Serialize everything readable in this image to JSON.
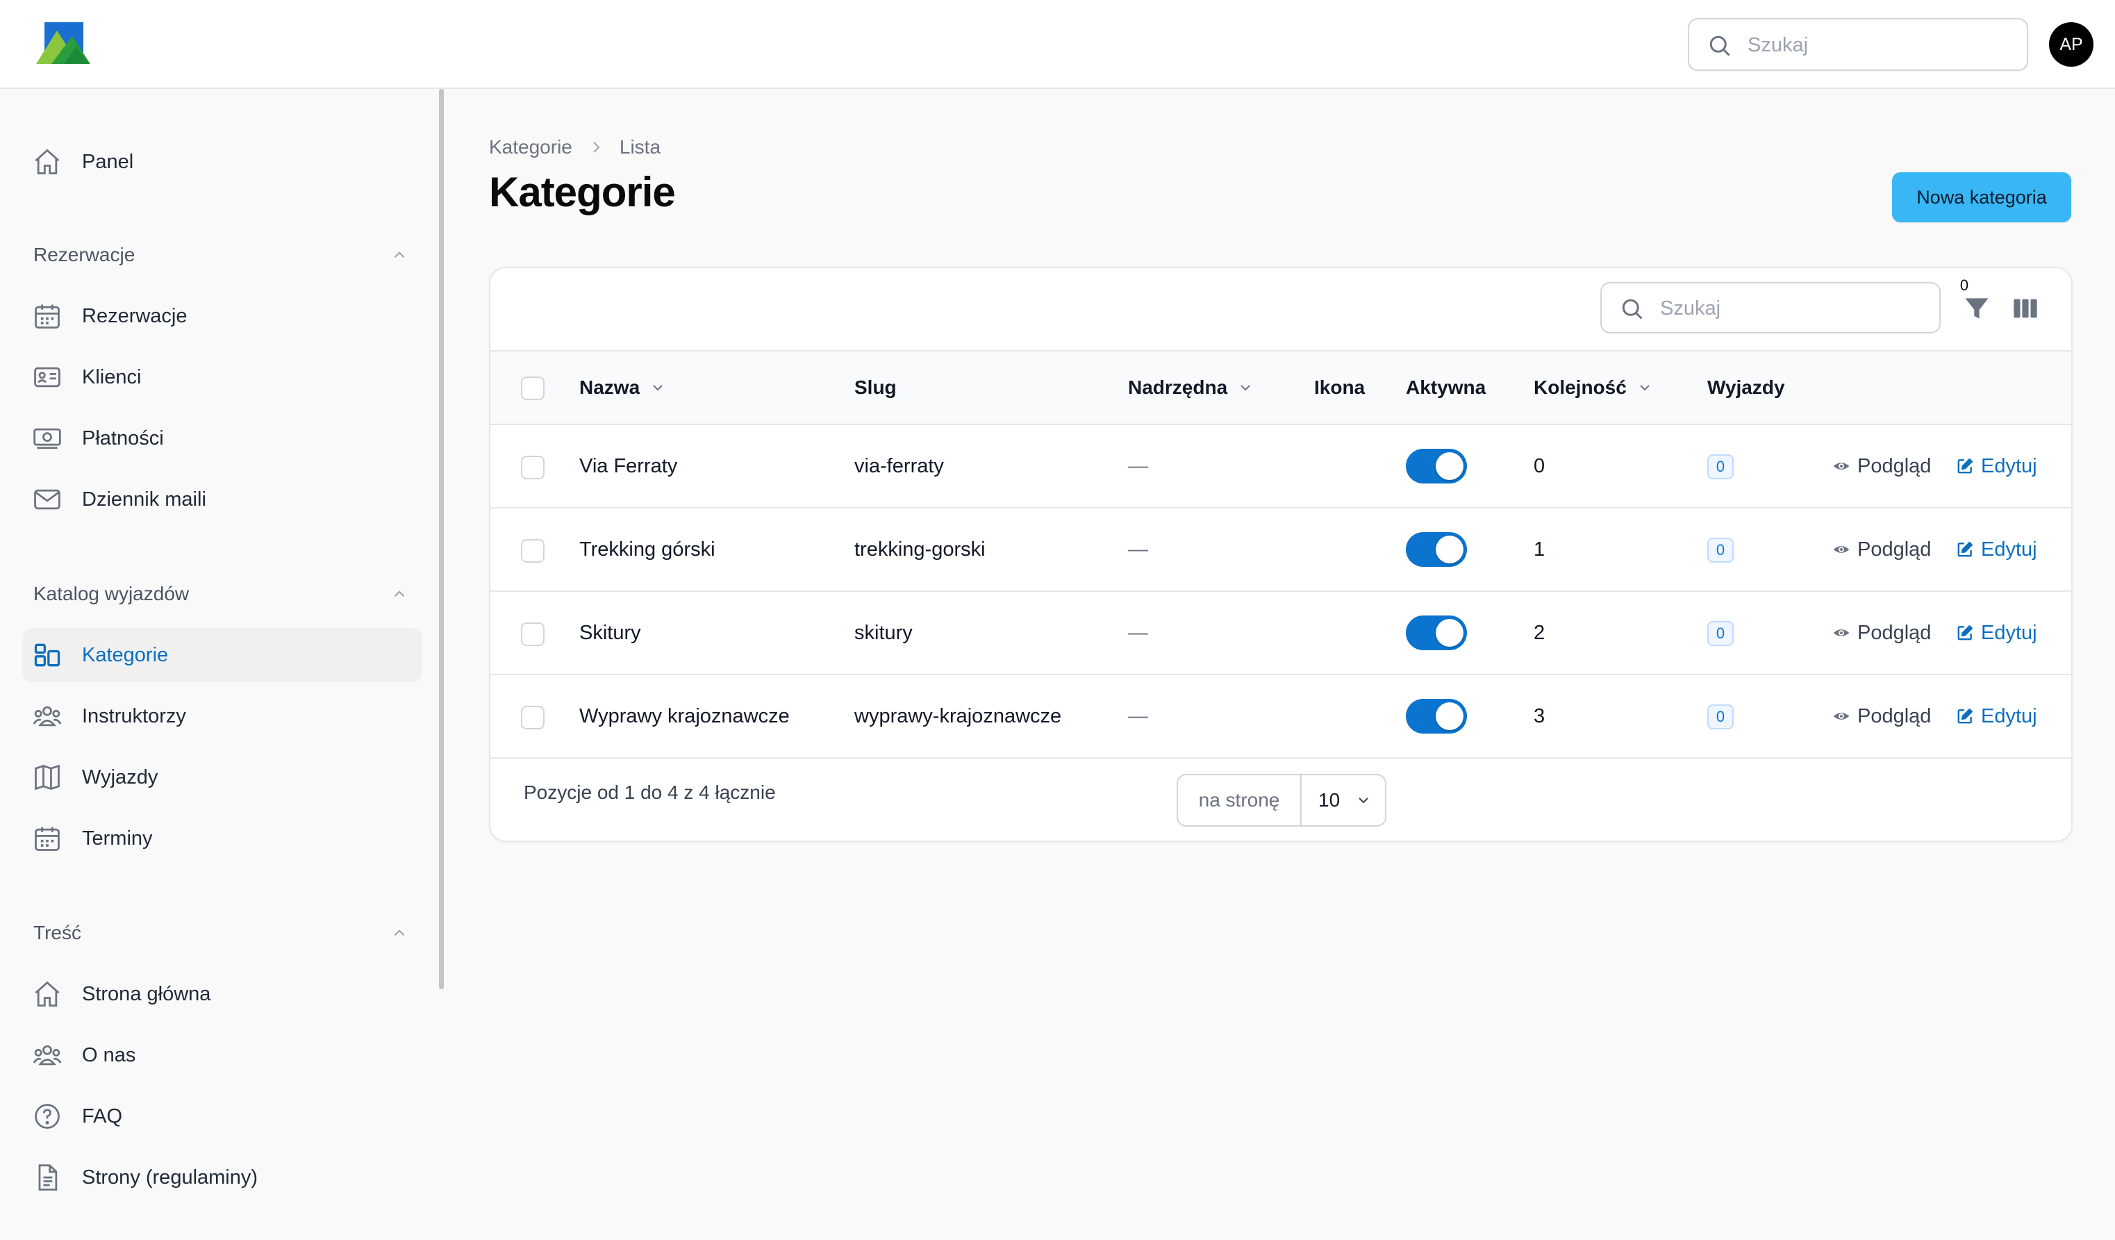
{
  "topbar": {
    "search_placeholder": "Szukaj",
    "avatar_initials": "AP"
  },
  "sidebar": {
    "top_item": {
      "label": "Panel",
      "icon": "home-icon"
    },
    "groups": [
      {
        "label": "Rezerwacje",
        "items": [
          {
            "label": "Rezerwacje",
            "icon": "calendar-icon"
          },
          {
            "label": "Klienci",
            "icon": "id-card-icon"
          },
          {
            "label": "Płatności",
            "icon": "cash-icon"
          },
          {
            "label": "Dziennik maili",
            "icon": "envelope-icon"
          }
        ]
      },
      {
        "label": "Katalog wyjazdów",
        "items": [
          {
            "label": "Kategorie",
            "icon": "squares-icon",
            "active": true
          },
          {
            "label": "Instruktorzy",
            "icon": "user-group-icon"
          },
          {
            "label": "Wyjazdy",
            "icon": "map-icon"
          },
          {
            "label": "Terminy",
            "icon": "calendar-icon"
          }
        ]
      },
      {
        "label": "Treść",
        "items": [
          {
            "label": "Strona główna",
            "icon": "home-icon"
          },
          {
            "label": "O nas",
            "icon": "user-group-icon"
          },
          {
            "label": "FAQ",
            "icon": "question-icon"
          },
          {
            "label": "Strony (regulaminy)",
            "icon": "document-icon"
          }
        ]
      }
    ]
  },
  "breadcrumb": [
    "Kategorie",
    "Lista"
  ],
  "page_title": "Kategorie",
  "new_button_label": "Nowa kategoria",
  "table": {
    "search_placeholder": "Szukaj",
    "filter_count": "0",
    "columns": [
      "Nazwa",
      "Slug",
      "Nadrzędna",
      "Ikona",
      "Aktywna",
      "Kolejność",
      "Wyjazdy"
    ],
    "rows": [
      {
        "name": "Via Ferraty",
        "slug": "via-ferraty",
        "parent": "—",
        "active": true,
        "order": "0",
        "trips": "0"
      },
      {
        "name": "Trekking górski",
        "slug": "trekking-gorski",
        "parent": "—",
        "active": true,
        "order": "1",
        "trips": "0"
      },
      {
        "name": "Skitury",
        "slug": "skitury",
        "parent": "—",
        "active": true,
        "order": "2",
        "trips": "0"
      },
      {
        "name": "Wyprawy krajoznawcze",
        "slug": "wyprawy-krajoznawcze",
        "parent": "—",
        "active": true,
        "order": "3",
        "trips": "0"
      }
    ],
    "view_label": "Podgląd",
    "edit_label": "Edytuj",
    "footer_text": "Pozycje od 1 do 4 z 4 łącznie",
    "per_page_label": "na stronę",
    "per_page_value": "10"
  },
  "colors": {
    "accent": "#0b74cf",
    "primary_button": "#38b6f5"
  }
}
